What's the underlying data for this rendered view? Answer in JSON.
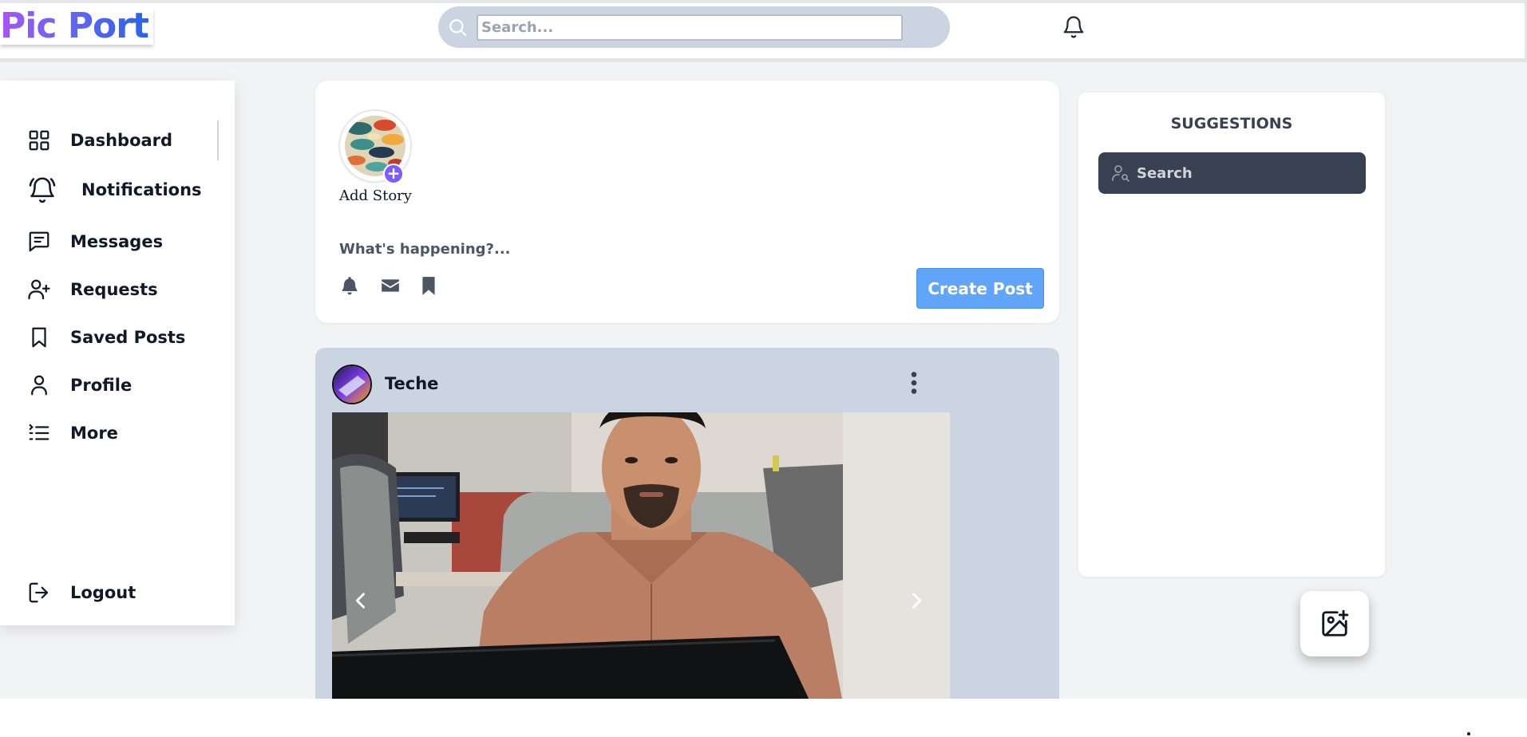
{
  "header": {
    "logo": "Pic Port",
    "search_placeholder": "Search...",
    "search_icon": "search-icon",
    "notification_icon": "bell-icon"
  },
  "sidebar": {
    "items": [
      {
        "label": "Dashboard",
        "icon": "grid-icon"
      },
      {
        "label": "Notifications",
        "icon": "bell-ring-icon"
      },
      {
        "label": "Messages",
        "icon": "message-square-icon"
      },
      {
        "label": "Requests",
        "icon": "user-plus-icon"
      },
      {
        "label": "Saved Posts",
        "icon": "bookmark-icon"
      },
      {
        "label": "Profile",
        "icon": "user-icon"
      },
      {
        "label": "More",
        "icon": "list-icon"
      }
    ],
    "logout": {
      "label": "Logout",
      "icon": "logout-icon"
    }
  },
  "composer": {
    "story_label": "Add Story",
    "placeholder": "What's happening?...",
    "icons": [
      "bell-icon",
      "envelope-icon",
      "bookmark-icon"
    ],
    "create_button": "Create Post"
  },
  "post": {
    "author": "Teche",
    "menu_icon": "more-vertical-icon",
    "prev_icon": "chevron-left-icon",
    "next_icon": "chevron-right-icon"
  },
  "suggestions": {
    "title": "SUGGESTIONS",
    "search_placeholder": "Search",
    "search_icon": "user-search-icon"
  },
  "fab": {
    "icon": "image-plus-icon"
  },
  "colors": {
    "primary_button": "#60a5fa",
    "post_background": "#cbd5e1",
    "search_dark": "#374151",
    "accent_purple": "#7c5cfc"
  }
}
